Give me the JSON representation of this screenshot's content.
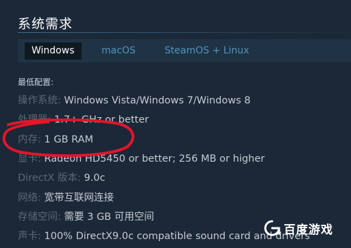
{
  "section": {
    "title": "系统需求"
  },
  "tabs": [
    {
      "label": "Windows",
      "active": true
    },
    {
      "label": "macOS",
      "active": false
    },
    {
      "label": "SteamOS + Linux",
      "active": false
    }
  ],
  "requirements": {
    "heading": "最低配置:",
    "os": {
      "label": "操作系统:",
      "value": "Windows Vista/Windows 7/Windows 8"
    },
    "cpu": {
      "label": "处理器:",
      "value": "1.7+ GHz or better"
    },
    "memory": {
      "label": "内存:",
      "value": "1 GB RAM"
    },
    "gpu": {
      "label": "显卡:",
      "value": "Radeon HD5450 or better; 256 MB or higher"
    },
    "directx": {
      "label": "DirectX 版本:",
      "value": "9.0c"
    },
    "network": {
      "label": "网络:",
      "value": "宽带互联网连接"
    },
    "storage": {
      "label": "存储空间:",
      "value": "需要 3 GB 可用空间"
    },
    "sound": {
      "label": "声卡:",
      "value": "100% DirectX9.0c compatible sound card and drivers"
    }
  },
  "annotation": {
    "color": "#e3162a"
  },
  "watermark": {
    "text": "百度游戏",
    "icon": "baidu-game-logo-icon"
  },
  "colors": {
    "background": "#1b2838",
    "tab_active_bg": "#0f1922",
    "tab_link": "#4f94bc",
    "label": "#5a6874",
    "value": "#c6ccd2"
  }
}
